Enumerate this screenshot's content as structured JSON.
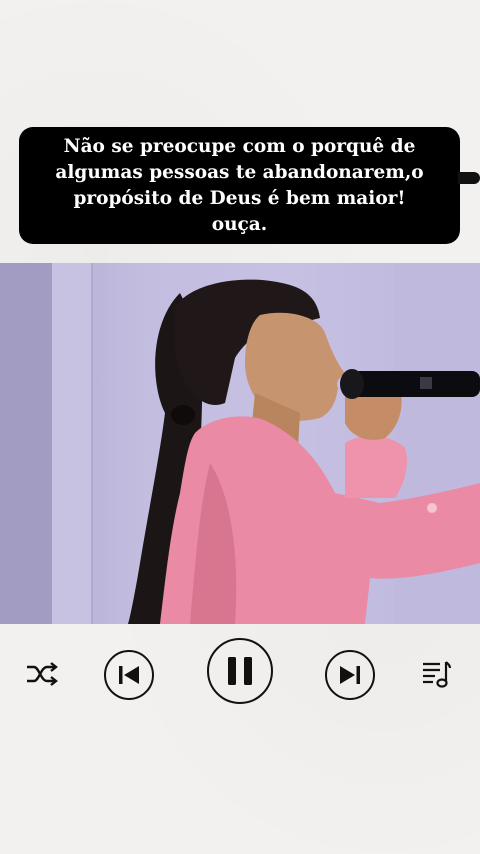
{
  "caption": {
    "text": "Não se preocupe com o porquê de algumas pessoas te abandonarem,o propósito de Deus é bem maior! ouça."
  },
  "video": {
    "description_icon": "video-frame"
  },
  "controls": {
    "shuffle_icon": "shuffle-icon",
    "previous_icon": "skip-previous-icon",
    "pause_icon": "pause-icon",
    "next_icon": "skip-next-icon",
    "playlist_icon": "playlist-icon"
  },
  "colors": {
    "background": "#f3f1ef",
    "caption_bg": "#000000",
    "caption_text": "#ffffff",
    "icon": "#111111"
  }
}
